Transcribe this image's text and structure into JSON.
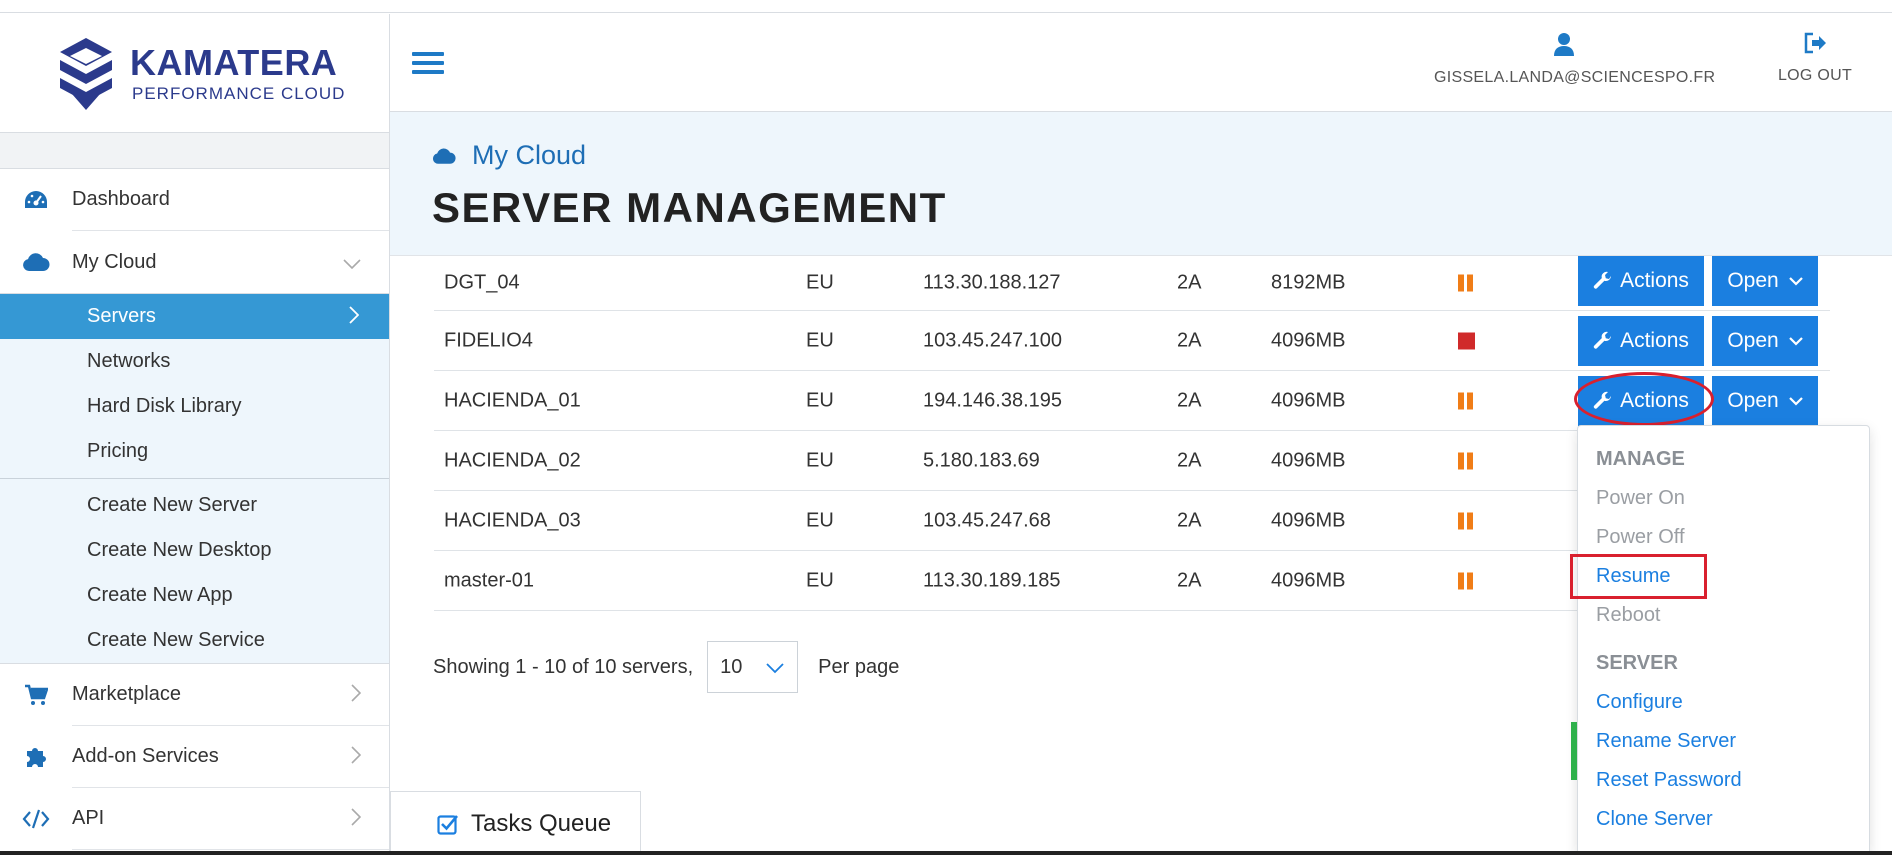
{
  "brand": {
    "title": "KAMATERA",
    "subtitle": "PERFORMANCE CLOUD",
    "color": "#2b3a8c"
  },
  "header": {
    "user_email": "GISSELA.LANDA@SCIENCESPO.FR",
    "logout_label": "LOG OUT",
    "accent": "#1e7ac6"
  },
  "sidebar": {
    "items": [
      {
        "label": "Dashboard",
        "icon": "dashboard-icon"
      },
      {
        "label": "My Cloud",
        "icon": "cloud-icon",
        "expanded": true
      },
      {
        "label": "Marketplace",
        "icon": "cart-icon"
      },
      {
        "label": "Add-on Services",
        "icon": "puzzle-icon"
      },
      {
        "label": "API",
        "icon": "code-icon"
      }
    ],
    "submenu": [
      {
        "label": "Servers",
        "active": true
      },
      {
        "label": "Networks"
      },
      {
        "label": "Hard Disk Library"
      },
      {
        "label": "Pricing"
      }
    ],
    "create_links": [
      {
        "label": "Create New Server"
      },
      {
        "label": "Create New Desktop"
      },
      {
        "label": "Create New App"
      },
      {
        "label": "Create New Service"
      }
    ]
  },
  "page": {
    "breadcrumb": "My Cloud",
    "title": "SERVER MANAGEMENT"
  },
  "servers": [
    {
      "name": "DGT_04",
      "location": "EU",
      "ip": "113.30.188.127",
      "cpu": "2A",
      "ram": "8192MB",
      "status": "paused"
    },
    {
      "name": "FIDELIO4",
      "location": "EU",
      "ip": "103.45.247.100",
      "cpu": "2A",
      "ram": "4096MB",
      "status": "stopped"
    },
    {
      "name": "HACIENDA_01",
      "location": "EU",
      "ip": "194.146.38.195",
      "cpu": "2A",
      "ram": "4096MB",
      "status": "paused"
    },
    {
      "name": "HACIENDA_02",
      "location": "EU",
      "ip": "5.180.183.69",
      "cpu": "2A",
      "ram": "4096MB",
      "status": "paused"
    },
    {
      "name": "HACIENDA_03",
      "location": "EU",
      "ip": "103.45.247.68",
      "cpu": "2A",
      "ram": "4096MB",
      "status": "paused"
    },
    {
      "name": "master-01",
      "location": "EU",
      "ip": "113.30.189.185",
      "cpu": "2A",
      "ram": "4096MB",
      "status": "paused"
    }
  ],
  "row_buttons": {
    "actions_label": "Actions",
    "open_label": "Open"
  },
  "pagination": {
    "summary": "Showing 1 - 10 of 10 servers,",
    "per_page_value": "10",
    "per_page_label": "Per page"
  },
  "actions_menu": {
    "manage_header": "MANAGE",
    "manage_items": [
      {
        "label": "Power On",
        "enabled": false
      },
      {
        "label": "Power Off",
        "enabled": false
      },
      {
        "label": "Resume",
        "enabled": true,
        "highlighted": true
      },
      {
        "label": "Reboot",
        "enabled": false
      }
    ],
    "server_header": "SERVER",
    "server_items": [
      {
        "label": "Configure"
      },
      {
        "label": "Rename Server"
      },
      {
        "label": "Reset Password"
      },
      {
        "label": "Clone Server"
      }
    ]
  },
  "tasks_queue": {
    "label": "Tasks Queue"
  },
  "colors": {
    "primary_button": "#1b7fe0",
    "active_nav": "#3598d4",
    "paused": "#f07d17",
    "stopped": "#d02a2a",
    "highlight": "#d9202e"
  }
}
